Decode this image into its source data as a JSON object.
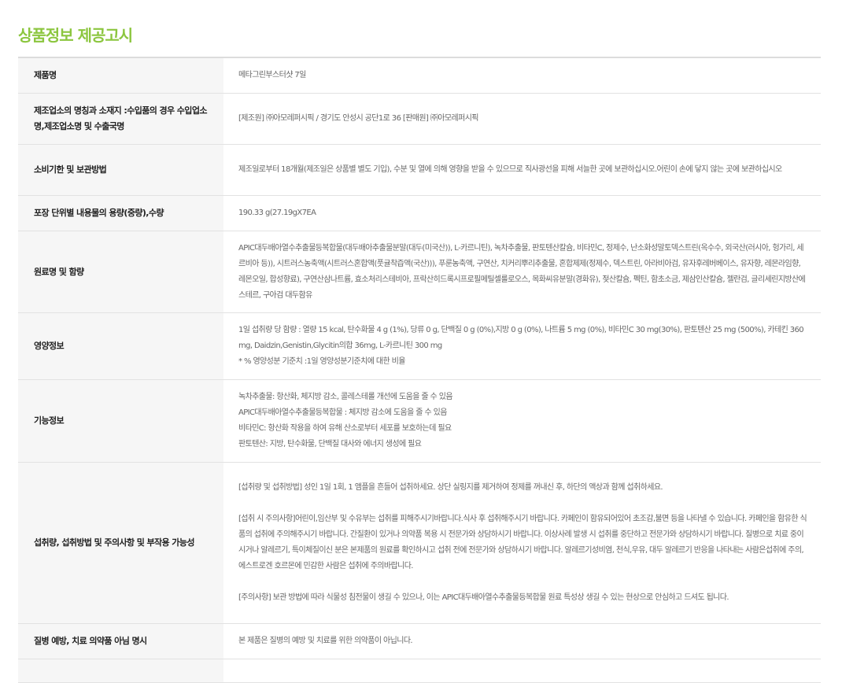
{
  "title": "상품정보 제공고시",
  "rows": [
    {
      "label": "제품명",
      "lines": [
        "메타그린부스터샷 7일"
      ]
    },
    {
      "label": "제조업소의 명칭과 소재지 :수입품의 경우 수입업소명,제조업소명 및 수출국명",
      "lines": [
        "[제조원] ㈜아모레퍼시픽 / 경기도 안성시 공단1로 36 [판매원] ㈜아모레퍼시픽"
      ]
    },
    {
      "label": "소비기한 및 보관방법",
      "lines": [
        "제조일로부터 18개월(제조일은 상품별 별도 기입), 수분 및 열에 의해 영향을 받을 수 있으므로 직사광선을 피해 서늘한 곳에 보관하십시오.어린이 손에 닿지 않는 곳에 보관하십시오"
      ]
    },
    {
      "label": "포장 단위별 내용물의 용량(중량),수량",
      "lines": [
        "190.33 g(27.19gX7EA"
      ]
    },
    {
      "label": "원료명 및 함량",
      "lines": [
        "APIC대두배아열수추출물등복합물(대두배아추출물분말(대두(미국산)), L-카르니틴), 녹차추출물, 판토텐산칼슘, 비타민C, 정제수, 난소화성말토덱스트린(옥수수, 외국산(러시아, 헝가리, 세르비아 등)), 시트러스농축액(시트러스혼합액(풋귤착즙액(국산))), 푸룬농축액, 구연산, 치커리뿌리추출물, 혼합제제(정제수, 덱스트린, 아라비아검, 유자후레버베이스, 유자향, 레몬라임향, 레몬오일, 합성향료), 구연산삼나트륨, 효소처리스테비아, 프락산히드록시프로필메틸셀룰로오스, 목화씨유분말(경화유), 젖산칼슘, 펙틴, 함초소금, 제삼인산칼슘, 젤란검, 글리세린지방산에스테르, 구아검 대두함유"
      ]
    },
    {
      "label": "영양정보",
      "lines": [
        "1일 섭취량 당 함량 : 열량 15 kcal, 탄수화물 4 g (1%), 당류 0 g, 단백질 0 g (0%),지방 0 g (0%), 나트륨 5 mg (0%), 비타민C 30 mg(30%), 판토텐산 25 mg (500%), 카테킨 360 mg, Daidzin,Genistin,Glycitin의합 36mg, L-카르니틴 300 mg",
        "* % 영양성분 기준치 :1일 영양성분기준치에 대한 비율"
      ]
    },
    {
      "label": "기능정보",
      "lines": [
        "녹차추출물: 항산화, 체지방 감소, 콜레스테롤 개선에 도움을 줄 수 있음",
        "APIC대두배아열수추출물등복합물 : 체지방 감소에 도움을 줄 수 있음",
        "비타민C: 항산화 작용을 하여 유해 산소로부터 세포를 보호하는데 필요",
        "판토텐산: 지방, 탄수화물, 단백질 대사와 에너지 생성에 필요"
      ]
    },
    {
      "label": "섭취량, 섭취방법 및 주의사항 및 부작용 가능성",
      "lines": [
        "[섭취량 및 섭취방법] 성인 1일 1회, 1 앰플을 흔들어 섭취하세요. 상단 실링지를 제거하여 정제를 꺼내신 후, 하단의 액상과 함께 섭취하세요.",
        "",
        "[섭취 시 주의사항]어린이,임산부 및 수유부는 섭취를 피해주시기바랍니다.식사 후 섭취해주시기 바랍니다. 카페인이 함유되어있어 초조감,불면 등을 나타낼 수 있습니다. 카페인을 함유한 식품의 섭취에 주의해주시기 바랍니다. 간질환이 있거나 의약품 복용 시 전문가와 상담하시기 바랍니다. 이상사례 발생 시 섭취를 중단하고 전문가와 상담하시기 바랍니다. 질병으로 치료 중이시거나 알레르기, 특이체질이신 분은 본제품의 원료를 확인하시고 섭취 전에 전문가와 상담하시기 바랍니다. 알레르기성비염, 천식,우유, 대두 알레르기 반응을 나타내는 사람은섭취에 주의,에스트로겐 호르몬에 민감한 사람은 섭취에 주의바랍니다.",
        "",
        "[주의사항] 보관 방법에 따라 식물성 침전물이 생길 수 있으나, 이는 APIC대두배아열수추출물등복합물 원료 특성상 생길 수 있는 현상으로 안심하고 드셔도 됩니다."
      ]
    },
    {
      "label": "질병 예방, 치료 의약품 아님 명시",
      "lines": [
        "본 제품은 질병의 예방 및 치료를 위한 의약품이 아닙니다."
      ]
    },
    {
      "label": "",
      "lines": [
        ""
      ]
    }
  ]
}
